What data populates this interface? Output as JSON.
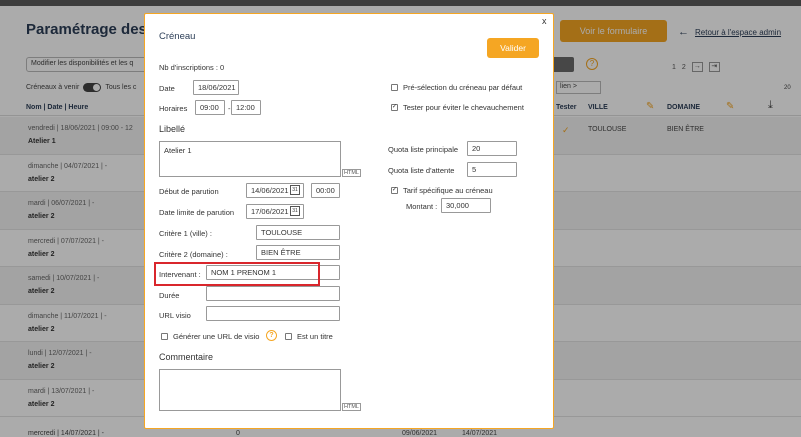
{
  "background": {
    "title": "Paramétrage des c",
    "view_form_button": "Voir le formulaire",
    "back_link": "Retour à l'espace admin",
    "modify_text": "Modifier les disponibilités et les q",
    "upcoming_label": "Créneaux à venir",
    "all_label": "Tous les c",
    "select_value": "lien >",
    "pager": [
      "1",
      "2"
    ],
    "pager_count": "20",
    "headers": {
      "name_date_time": "Nom | Date | Heure",
      "tester": "Tester",
      "city": "VILLE",
      "domain": "DOMAINE"
    },
    "rows": [
      {
        "date": "vendredi | 18/06/2021 | 09:00 - 12",
        "name": "Atelier 1",
        "check": "✓",
        "city": "TOULOUSE",
        "domain": "BIEN ÊTRE"
      },
      {
        "date": "dimanche | 04/07/2021 | -",
        "name": "atelier 2",
        "check": "",
        "city": "",
        "domain": ""
      },
      {
        "date": "mardi | 06/07/2021 | -",
        "name": "atelier 2",
        "check": "",
        "city": "",
        "domain": ""
      },
      {
        "date": "mercredi | 07/07/2021 | -",
        "name": "atelier 2",
        "check": "",
        "city": "",
        "domain": ""
      },
      {
        "date": "samedi | 10/07/2021 | -",
        "name": "atelier 2",
        "check": "",
        "city": "",
        "domain": ""
      },
      {
        "date": "dimanche | 11/07/2021 | -",
        "name": "atelier 2",
        "check": "",
        "city": "",
        "domain": ""
      },
      {
        "date": "lundi | 12/07/2021 | -",
        "name": "atelier 2",
        "check": "",
        "city": "",
        "domain": ""
      },
      {
        "date": "mardi | 13/07/2021 | -",
        "name": "atelier 2",
        "check": "",
        "city": "",
        "domain": ""
      }
    ],
    "last_row": {
      "date": "mercredi | 14/07/2021 | -",
      "count": "0",
      "start": "09/06/2021",
      "end": "14/07/2021"
    }
  },
  "modal": {
    "close": "x",
    "title": "Créneau",
    "validate_button": "Valider",
    "registrations": "Nb d'inscriptions : 0",
    "date_label": "Date",
    "date_value": "18/06/2021",
    "hours_label": "Horaires",
    "hours_start": "09:00",
    "hours_sep": "-",
    "hours_end": "12:00",
    "label_section": "Libellé",
    "label_value": "Atelier 1",
    "html_tag": "HTML",
    "pub_start_label": "Début de parution",
    "pub_start_date": "14/06/2021",
    "pub_start_time": "00:00",
    "pub_end_label": "Date limite de parution",
    "pub_end_date": "17/06/2021",
    "criteria1_label": "Critère 1 (ville) :",
    "criteria1_value": "TOULOUSE",
    "criteria2_label": "Critère 2 (domaine) :",
    "criteria2_value": "BIEN ÊTRE",
    "speaker_label": "Intervenant :",
    "speaker_value": "NOM 1 PRENOM 1",
    "duration_label": "Durée",
    "duration_value": "",
    "visio_label": "URL visio",
    "visio_value": "",
    "gen_visio_label": "Générer une URL de visio",
    "is_title_label": "Est un titre",
    "comment_section": "Commentaire",
    "comment_value": "",
    "preselect_label": "Pré-sélection du créneau par défaut",
    "overlap_label": "Tester pour éviter le chevauchement",
    "quota_main_label": "Quota liste principale",
    "quota_main_value": "20",
    "quota_wait_label": "Quota liste d'attente",
    "quota_wait_value": "5",
    "specific_rate_label": "Tarif spécifique au créneau",
    "amount_label": "Montant :",
    "amount_value": "30,000",
    "check_mark": "✓"
  },
  "colors": {
    "accent": "#f5a623",
    "title": "#2c3e57",
    "highlight": "#d9262c"
  }
}
